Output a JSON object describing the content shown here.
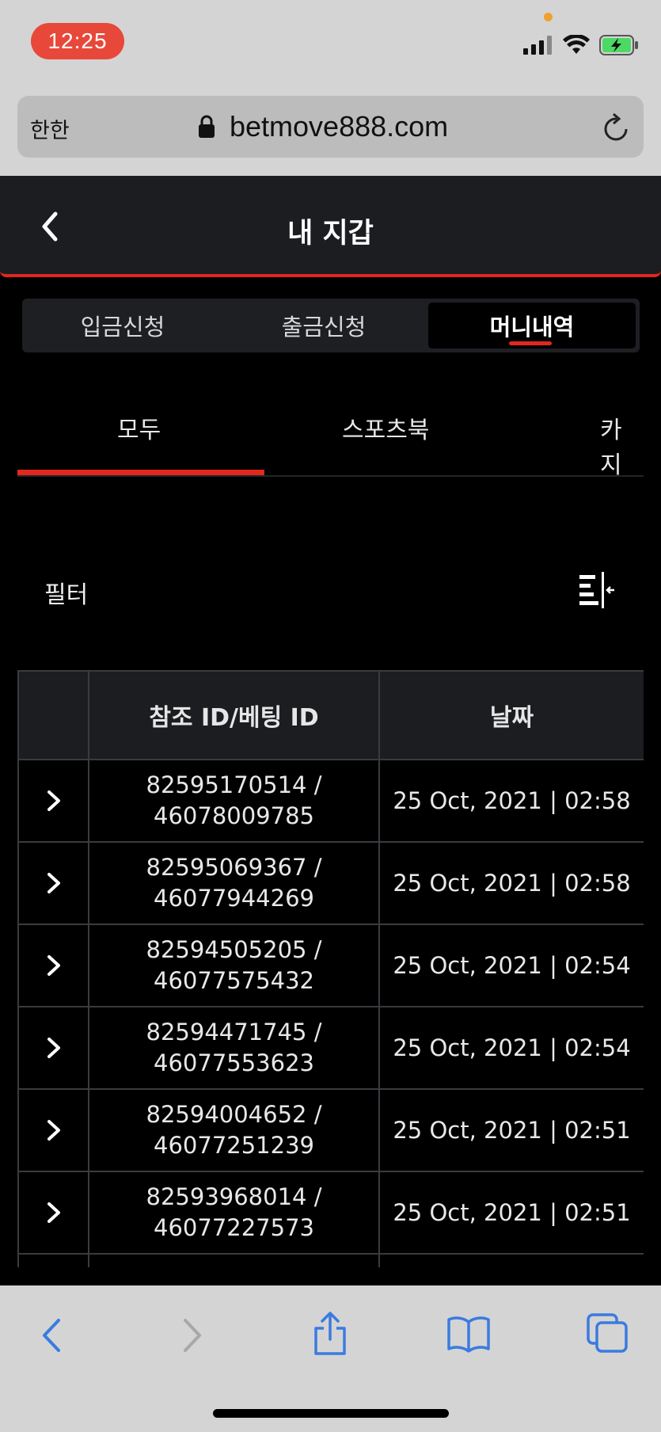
{
  "status_bar": {
    "time": "12:25"
  },
  "browser": {
    "reader_label": "한한",
    "url": "betmove888.com"
  },
  "header": {
    "title": "내 지갑"
  },
  "segments": [
    {
      "label": "입금신청"
    },
    {
      "label": "출금신청"
    },
    {
      "label": "머니내역",
      "active": true
    }
  ],
  "subtabs": [
    {
      "label": "모두",
      "active": true
    },
    {
      "label": "스포츠북"
    },
    {
      "label": "카지"
    }
  ],
  "filter": {
    "label": "필터"
  },
  "table": {
    "columns": [
      "",
      "참조 ID/베팅 ID",
      "날짜"
    ],
    "rows": [
      {
        "ref": "82595170514 /",
        "bet": "46078009785",
        "date": "25 Oct, 2021 | 02:58"
      },
      {
        "ref": "82595069367 /",
        "bet": "46077944269",
        "date": "25 Oct, 2021 | 02:58"
      },
      {
        "ref": "82594505205 /",
        "bet": "46077575432",
        "date": "25 Oct, 2021 | 02:54"
      },
      {
        "ref": "82594471745 /",
        "bet": "46077553623",
        "date": "25 Oct, 2021 | 02:54"
      },
      {
        "ref": "82594004652 /",
        "bet": "46077251239",
        "date": "25 Oct, 2021 | 02:51"
      },
      {
        "ref": "82593968014 /",
        "bet": "46077227573",
        "date": "25 Oct, 2021 | 02:51"
      },
      {
        "ref": "",
        "bet": "",
        "date": ""
      }
    ]
  },
  "colors": {
    "accent": "#e0281c",
    "link_blue": "#3a7be0"
  }
}
